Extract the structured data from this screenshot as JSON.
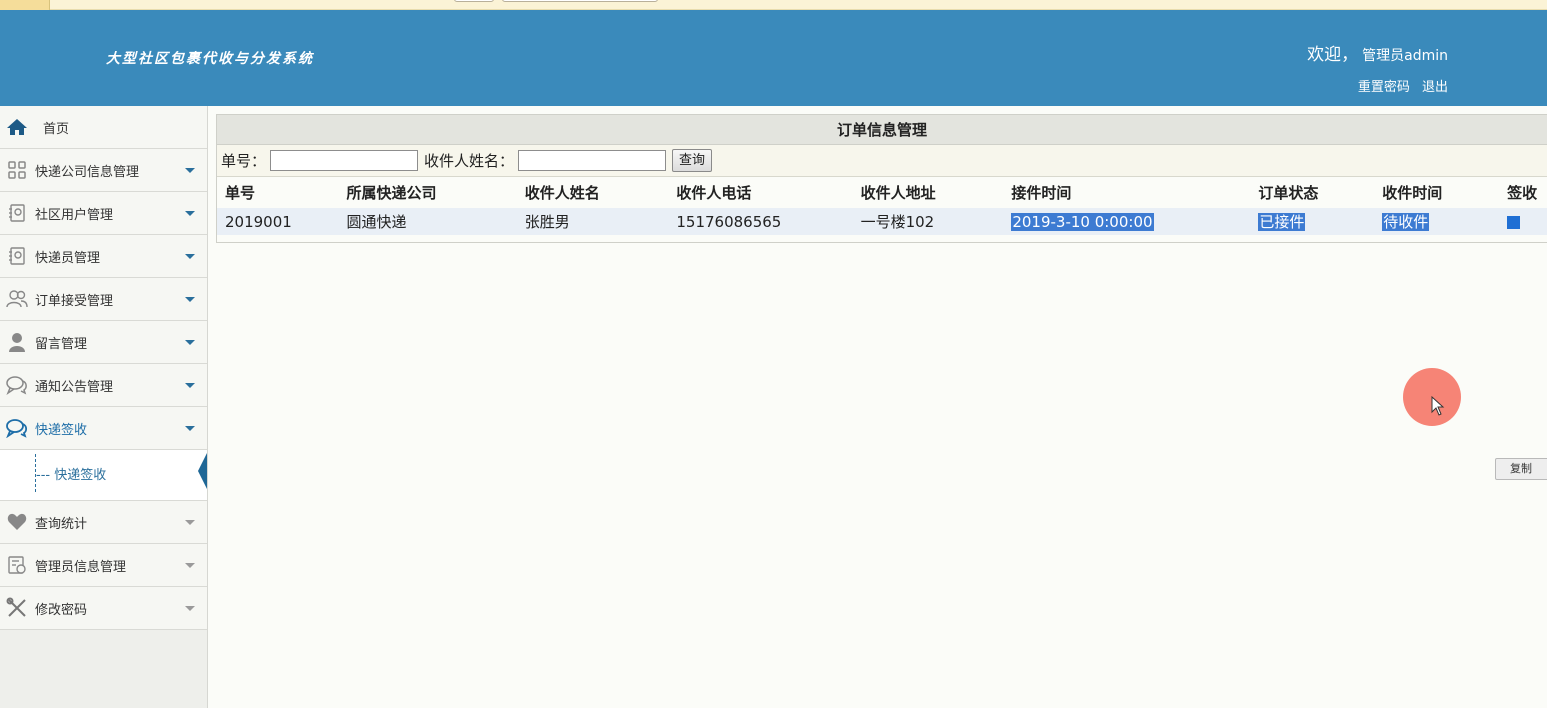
{
  "header": {
    "logo_text": "大型社区包裹代收与分发系统",
    "welcome": "欢迎，",
    "user": "管理员admin",
    "reset_password": "重置密码",
    "logout": "退出"
  },
  "sidebar": {
    "items": [
      {
        "label": "首页",
        "icon": "home-icon"
      },
      {
        "label": "快递公司信息管理",
        "icon": "grid-icon"
      },
      {
        "label": "社区用户管理",
        "icon": "contacts-icon"
      },
      {
        "label": "快递员管理",
        "icon": "contacts-icon"
      },
      {
        "label": "订单接受管理",
        "icon": "users-icon"
      },
      {
        "label": "留言管理",
        "icon": "user-icon"
      },
      {
        "label": "通知公告管理",
        "icon": "chat-icon"
      },
      {
        "label": "快递签收",
        "icon": "chat-icon"
      },
      {
        "label": "查询统计",
        "icon": "heart-icon"
      },
      {
        "label": "管理员信息管理",
        "icon": "id-card-icon"
      },
      {
        "label": "修改密码",
        "icon": "tools-icon"
      }
    ],
    "submenu": {
      "label": "快递签收"
    }
  },
  "main": {
    "title": "订单信息管理",
    "search": {
      "order_no_label": "单号：",
      "recipient_label": "收件人姓名：",
      "query_button": "查询"
    },
    "table": {
      "headers": [
        "单号",
        "所属快递公司",
        "收件人姓名",
        "收件人电话",
        "收件人地址",
        "接件时间",
        "订单状态",
        "收件时间",
        "签收"
      ],
      "rows": [
        [
          "2019001",
          "圆通快递",
          "张胜男",
          "15176086565",
          "一号楼102",
          "2019-3-10 0:00:00",
          "已接件",
          "待收件",
          ""
        ]
      ]
    }
  },
  "copy_button": "复制",
  "colors": {
    "header_bg": "#3a8abb",
    "selection": "#3d7bd2",
    "accent": "#1e6ea8"
  }
}
